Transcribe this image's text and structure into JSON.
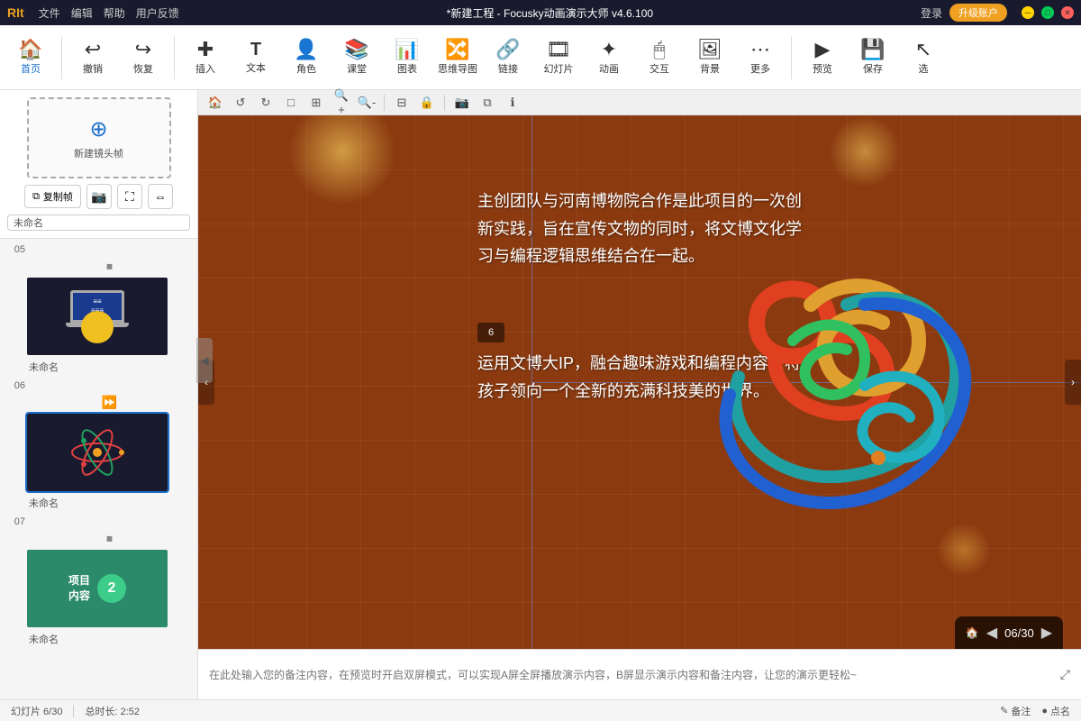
{
  "titlebar": {
    "logo": "RIt",
    "menu": [
      "文件",
      "编辑",
      "帮助",
      "用户反馈"
    ],
    "title": "*新建工程 - Focusky动画演示大师 v4.6.100",
    "login": "登录",
    "upgrade": "升级账户"
  },
  "toolbar": {
    "items": [
      {
        "id": "home",
        "icon": "🏠",
        "label": "首页"
      },
      {
        "id": "undo",
        "icon": "↩",
        "label": "撤销"
      },
      {
        "id": "redo",
        "icon": "↪",
        "label": "恢复"
      },
      {
        "id": "insert",
        "icon": "➕",
        "label": "插入"
      },
      {
        "id": "text",
        "icon": "T",
        "label": "文本"
      },
      {
        "id": "role",
        "icon": "👤",
        "label": "角色"
      },
      {
        "id": "classroom",
        "icon": "📚",
        "label": "课堂"
      },
      {
        "id": "chart",
        "icon": "📊",
        "label": "图表"
      },
      {
        "id": "mindmap",
        "icon": "🧠",
        "label": "思维导图"
      },
      {
        "id": "link",
        "icon": "🔗",
        "label": "链接"
      },
      {
        "id": "ppt",
        "icon": "🎞",
        "label": "幻灯片"
      },
      {
        "id": "anim",
        "icon": "✨",
        "label": "动画"
      },
      {
        "id": "interact",
        "icon": "🖱",
        "label": "交互"
      },
      {
        "id": "bg",
        "icon": "🖼",
        "label": "背景"
      },
      {
        "id": "more",
        "icon": "⋯",
        "label": "更多"
      },
      {
        "id": "preview",
        "icon": "▶",
        "label": "预览"
      },
      {
        "id": "save",
        "icon": "💾",
        "label": "保存"
      },
      {
        "id": "select",
        "icon": "↖",
        "label": "选"
      }
    ]
  },
  "sidebar": {
    "new_frame_label": "新建镜头帧",
    "copy_btn": "复制帧",
    "slide_name_placeholder": "未命名",
    "slides": [
      {
        "num": "05",
        "name": "未命名",
        "type": "laptop",
        "active": false
      },
      {
        "num": "06",
        "name": "未命名",
        "type": "atom",
        "active": true
      },
      {
        "num": "07",
        "name": "未命名",
        "type": "project",
        "active": false
      }
    ]
  },
  "canvas": {
    "text1": "主创团队与河南博物院合作是此项目的一次创新实践，旨在宣传文物的同时，将文博文化学习与编程逻辑思维结合在一起。",
    "text2": "运用文博大IP，融合趣味游戏和编程内容，将孩子领向一个全新的充满科技美的世界。",
    "frame_num": "6",
    "nav_page": "06/30"
  },
  "notes": {
    "placeholder": "在此处输入您的备注内容，在预览时开启双屏模式，可以实现A屏全屏播放演示内容，B屏显示演示内容和备注内容，让您的演示更轻松~"
  },
  "statusbar": {
    "slide_info": "幻灯片 6/30",
    "duration": "总时长: 2:52",
    "annotation": "备注",
    "dot_name": "点名"
  }
}
